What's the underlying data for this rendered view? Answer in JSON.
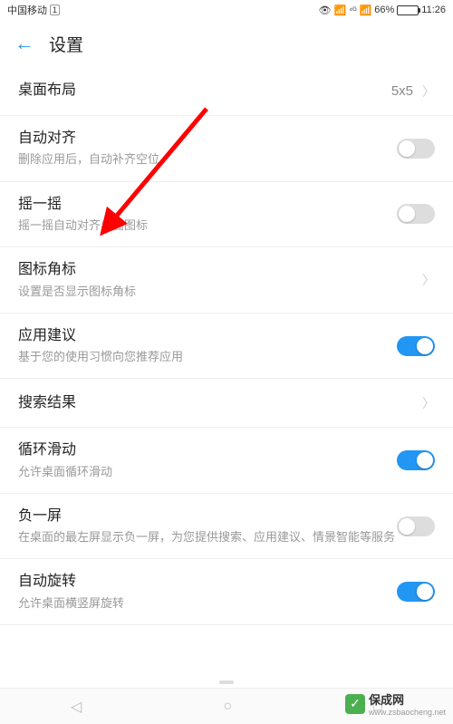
{
  "status": {
    "carrier": "中国移动",
    "sim": "1",
    "network": "4G",
    "signal": "64%",
    "battery": "66%",
    "time": "11:26"
  },
  "header": {
    "title": "设置"
  },
  "items": {
    "layout": {
      "title": "桌面布局",
      "value": "5x5"
    },
    "align": {
      "title": "自动对齐",
      "sub": "删除应用后，自动补齐空位",
      "on": false
    },
    "shake": {
      "title": "摇一摇",
      "sub": "摇一摇自动对齐桌面图标",
      "on": false
    },
    "badge": {
      "title": "图标角标",
      "sub": "设置是否显示图标角标"
    },
    "suggest": {
      "title": "应用建议",
      "sub": "基于您的使用习惯向您推荐应用",
      "on": true
    },
    "search": {
      "title": "搜索结果"
    },
    "loop": {
      "title": "循环滑动",
      "sub": "允许桌面循环滑动",
      "on": true
    },
    "minus": {
      "title": "负一屏",
      "sub": "在桌面的最左屏显示负一屏，为您提供搜索、应用建议、情景智能等服务",
      "on": false
    },
    "rotate": {
      "title": "自动旋转",
      "sub": "允许桌面横竖屏旋转",
      "on": true
    }
  },
  "watermark": {
    "name": "保成网",
    "url": "www.zsbaocheng.net"
  }
}
